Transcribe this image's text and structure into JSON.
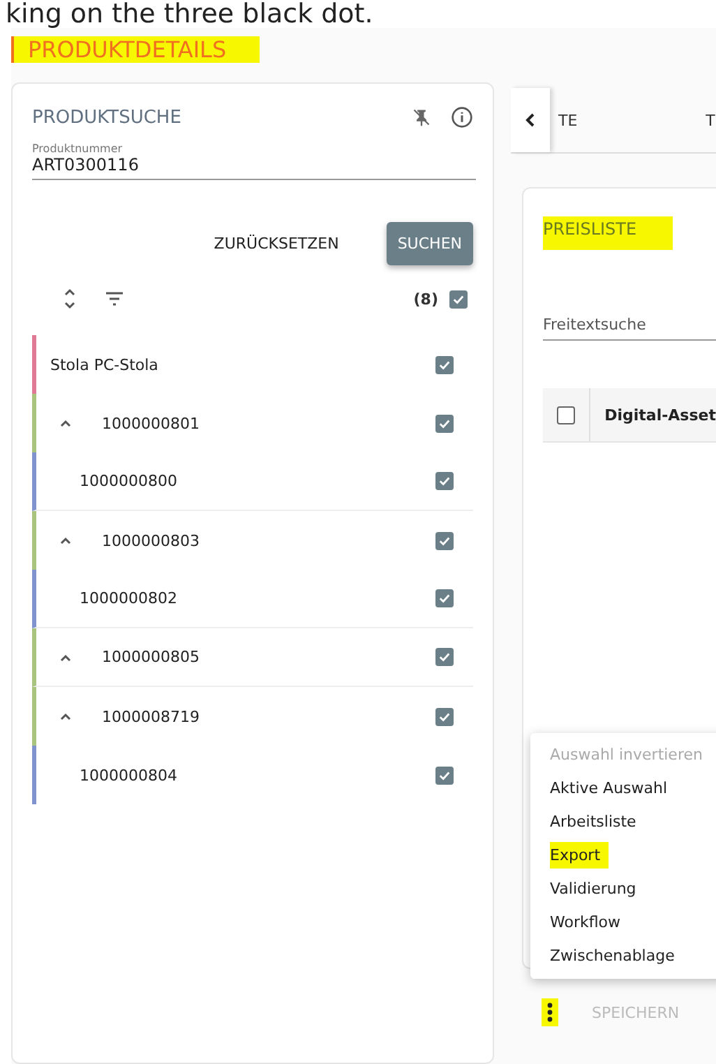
{
  "caption": "king on the three black dot.",
  "header": {
    "title": "PRODUKTDETAILS",
    "highlighted": true
  },
  "search_panel": {
    "title": "PRODUKTSUCHE",
    "field": {
      "label": "Produktnummer",
      "value": "ART0300116"
    },
    "buttons": [
      {
        "label": "ZURÜCKSETZEN",
        "kind": "text"
      },
      {
        "label": "SUCHEN",
        "kind": "filled"
      }
    ],
    "count": "(8)",
    "all_checked": true
  },
  "tree": [
    {
      "label": "Stola PC-Stola",
      "color": "#e07a96",
      "checked": true,
      "children": [
        {
          "label": "1000000801",
          "color": "#a9c47f",
          "checked": true,
          "expanded": true,
          "children": [
            {
              "label": "1000000800",
              "color": "#8193cf",
              "checked": true
            }
          ]
        },
        {
          "label": "1000000803",
          "color": "#a9c47f",
          "checked": true,
          "expanded": true,
          "children": [
            {
              "label": "1000000802",
              "color": "#8193cf",
              "checked": true
            }
          ]
        },
        {
          "label": "1000000805",
          "color": "#a9c47f",
          "checked": true,
          "expanded": true
        },
        {
          "label": "1000008719",
          "color": "#a9c47f",
          "checked": true,
          "expanded": true,
          "children": [
            {
              "label": "1000000804",
              "color": "#8193cf",
              "checked": true
            }
          ]
        }
      ]
    }
  ],
  "tabs": [
    {
      "label": "TE",
      "selected": false
    },
    {
      "label": "T",
      "selected": false
    }
  ],
  "price_panel": {
    "title": "PREISLISTE",
    "title_highlighted": true,
    "search": {
      "placeholder": "Freitextsuche"
    },
    "table": {
      "columns": [
        "Digital-Asset"
      ],
      "all_checked": false
    }
  },
  "menu": [
    {
      "label": "Auswahl invertieren",
      "disabled": true,
      "highlighted": false
    },
    {
      "label": "Aktive Auswahl",
      "disabled": false,
      "highlighted": false
    },
    {
      "label": "Arbeitsliste",
      "disabled": false,
      "highlighted": false
    },
    {
      "label": "Export",
      "disabled": false,
      "highlighted": true
    },
    {
      "label": "Validierung",
      "disabled": false,
      "highlighted": false
    },
    {
      "label": "Workflow",
      "disabled": false,
      "highlighted": false
    },
    {
      "label": "Zwischenablage",
      "disabled": false,
      "highlighted": false
    }
  ],
  "footer": {
    "more_highlighted": true,
    "save": {
      "label": "SPEICHERN",
      "disabled": true
    }
  }
}
